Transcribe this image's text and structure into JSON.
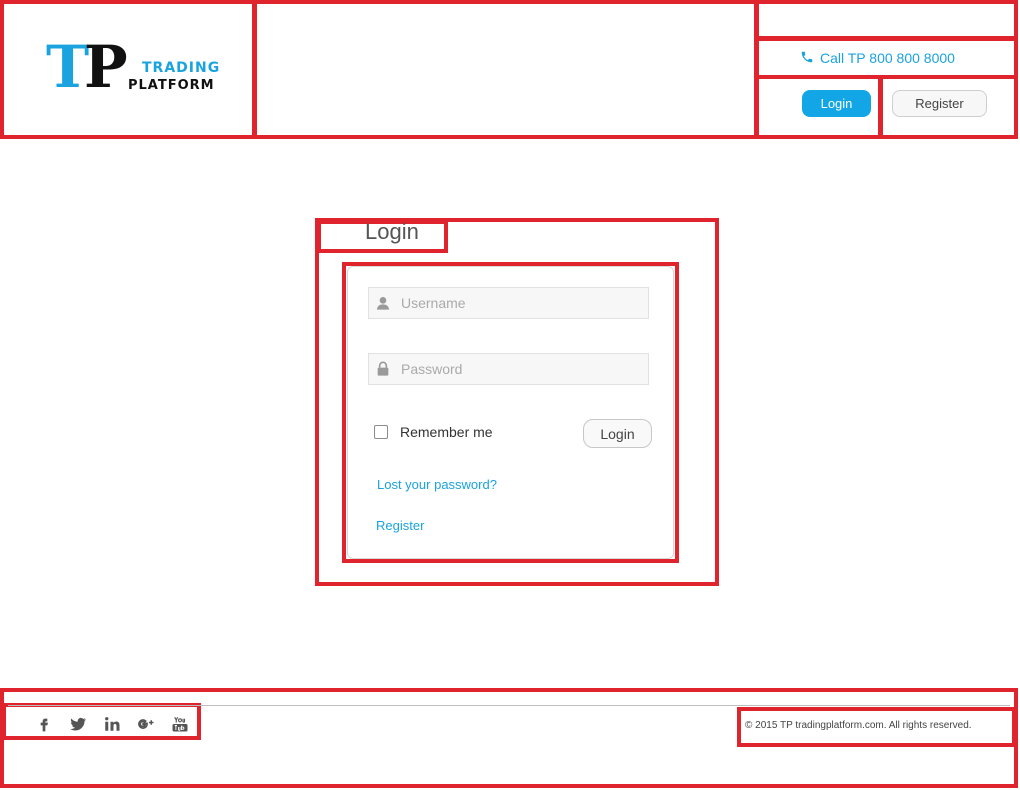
{
  "header": {
    "logo": {
      "t": "T",
      "p": "P",
      "trading": "TRADING",
      "platform": "PLATFORM"
    },
    "call_text": "Call TP 800 800 8000",
    "login_button": "Login",
    "register_button": "Register"
  },
  "login": {
    "title": "Login",
    "username_placeholder": "Username",
    "password_placeholder": "Password",
    "remember_label": "Remember me",
    "login_button": "Login",
    "lost_password_link": "Lost your password?",
    "register_link": "Register"
  },
  "footer": {
    "social": [
      "facebook-icon",
      "twitter-icon",
      "linkedin-icon",
      "googleplus-icon",
      "youtube-icon"
    ],
    "copyright": "© 2015 TP tradingplatform.com. All rights reserved."
  },
  "colors": {
    "accent": "#1aa3df",
    "annotation": "#e0242e"
  }
}
